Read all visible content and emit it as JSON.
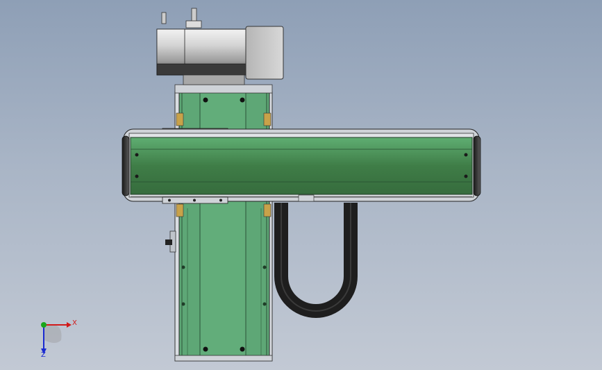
{
  "axis_triad": {
    "x_label": "X",
    "z_label": "Z",
    "x_color": "#d11a1a",
    "y_color": "#1aa61a",
    "z_color": "#1a2ad1"
  },
  "colors": {
    "profile_green": "#5aa574",
    "belt_green": "#3d7a45",
    "motor_grey": "#c5c5c5",
    "cable_black": "#222222"
  }
}
